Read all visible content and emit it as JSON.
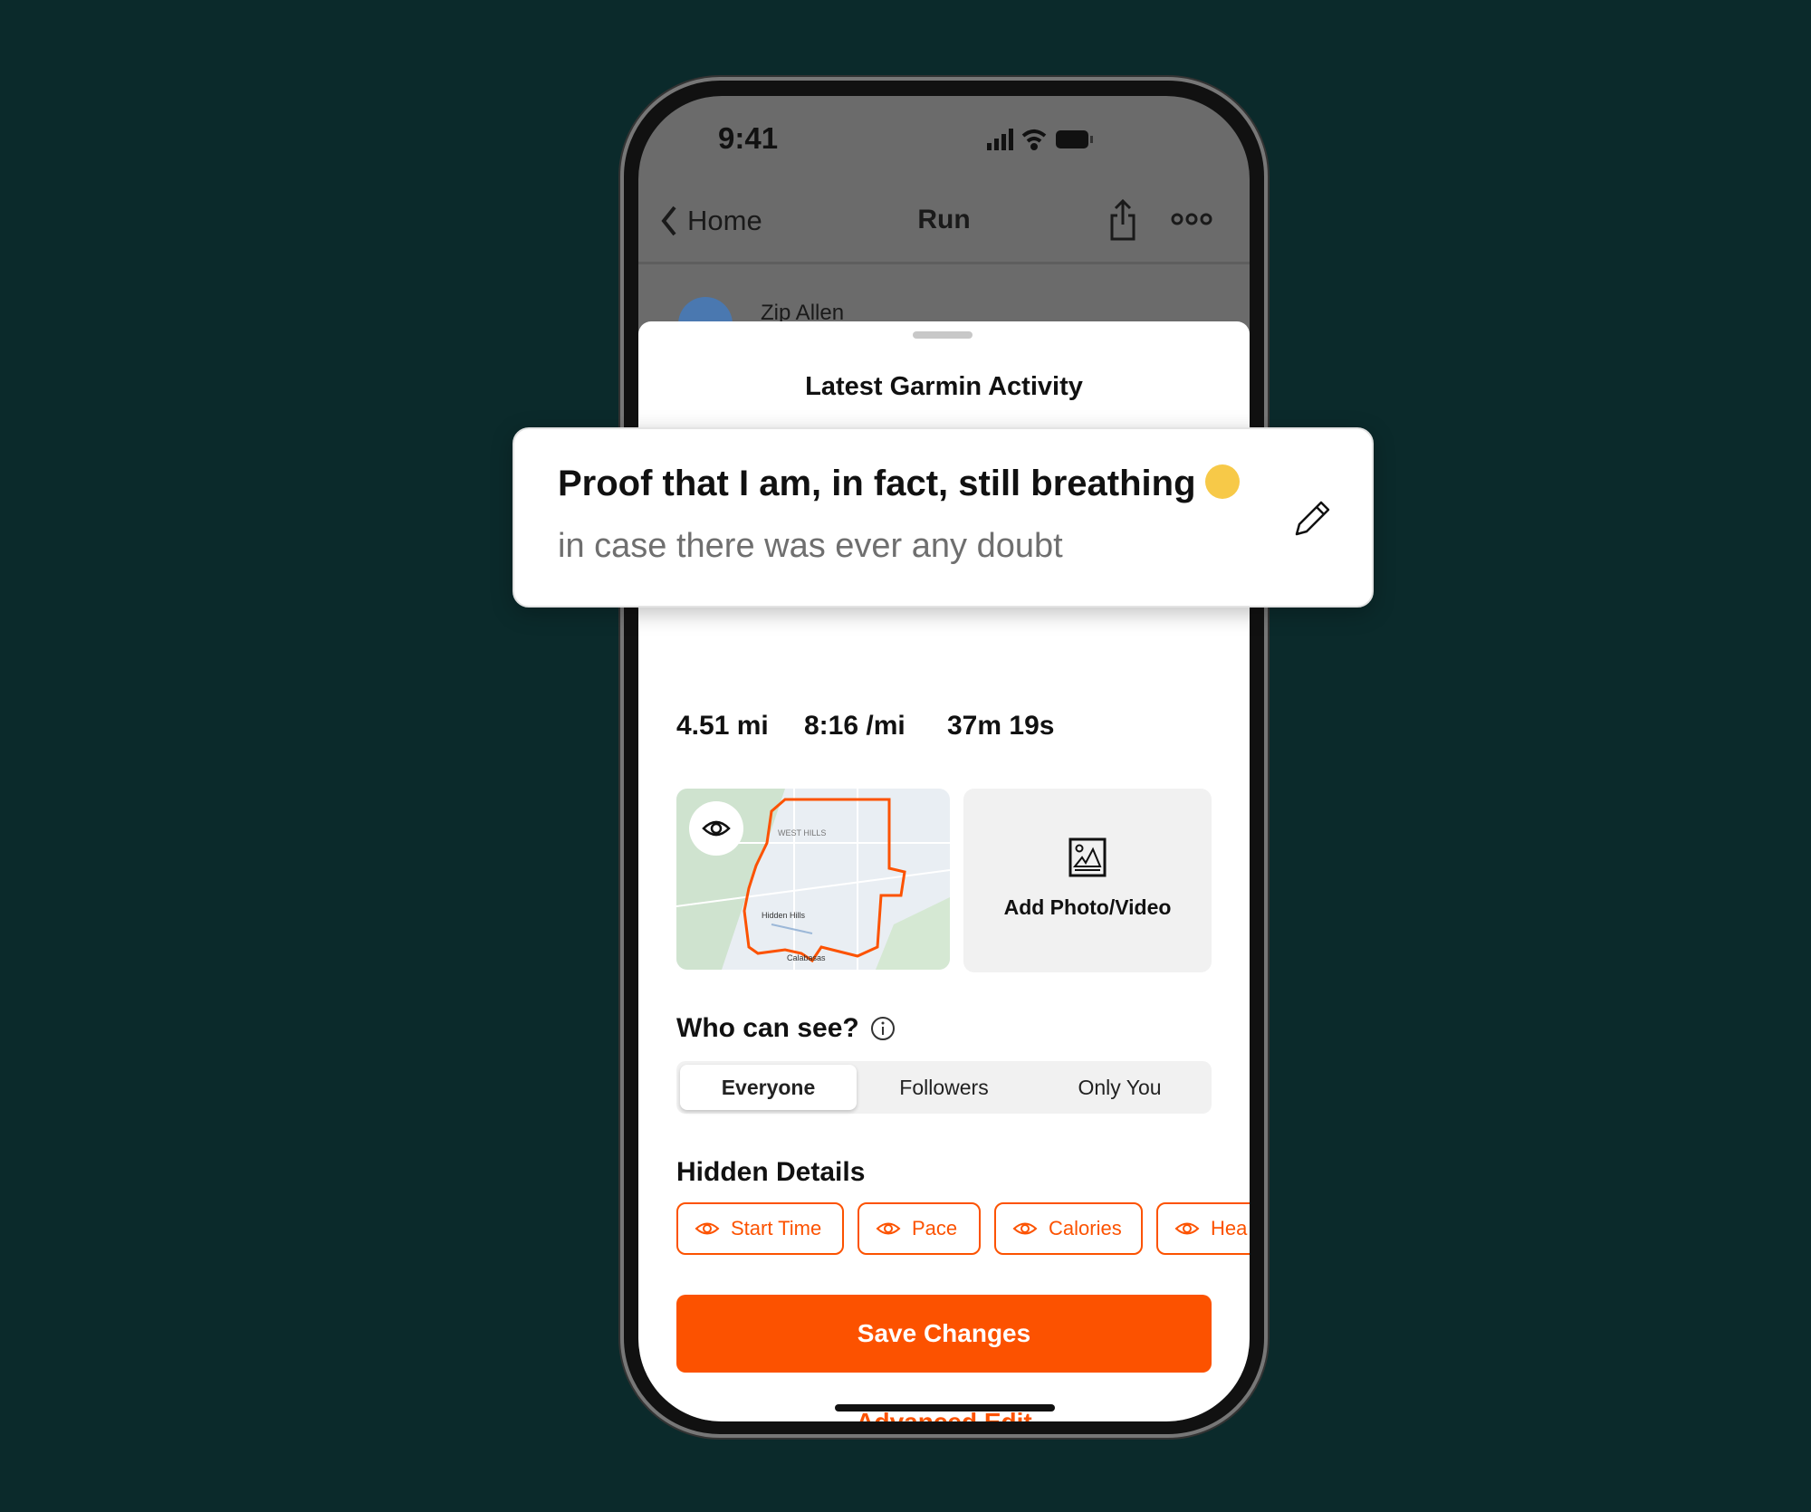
{
  "status_bar": {
    "time": "9:41"
  },
  "nav": {
    "back_label": "Home",
    "title": "Run"
  },
  "background_content": {
    "user_name": "Zip Allen"
  },
  "sheet": {
    "title": "Latest Garmin Activity"
  },
  "activity": {
    "title": "Proof that I am, in fact, still breathing",
    "title_emoji": "exhaling-face",
    "subtitle": "in case there was ever any doubt"
  },
  "stats": {
    "distance": "4.51 mi",
    "pace": "8:16 /mi",
    "time": "37m 19s"
  },
  "map": {
    "labels": [
      "WEST HILLS",
      "Hidden Hills",
      "Calabasas"
    ]
  },
  "media": {
    "add_label": "Add Photo/Video"
  },
  "visibility": {
    "label": "Who can see?",
    "options": [
      "Everyone",
      "Followers",
      "Only You"
    ],
    "selected": "Everyone"
  },
  "hidden_details": {
    "title": "Hidden Details",
    "chips": [
      "Start Time",
      "Pace",
      "Calories",
      "Hea"
    ]
  },
  "actions": {
    "save": "Save Changes",
    "advanced": "Advanced Edit"
  },
  "colors": {
    "accent": "#fc5200",
    "background": "#0b2a2b"
  }
}
